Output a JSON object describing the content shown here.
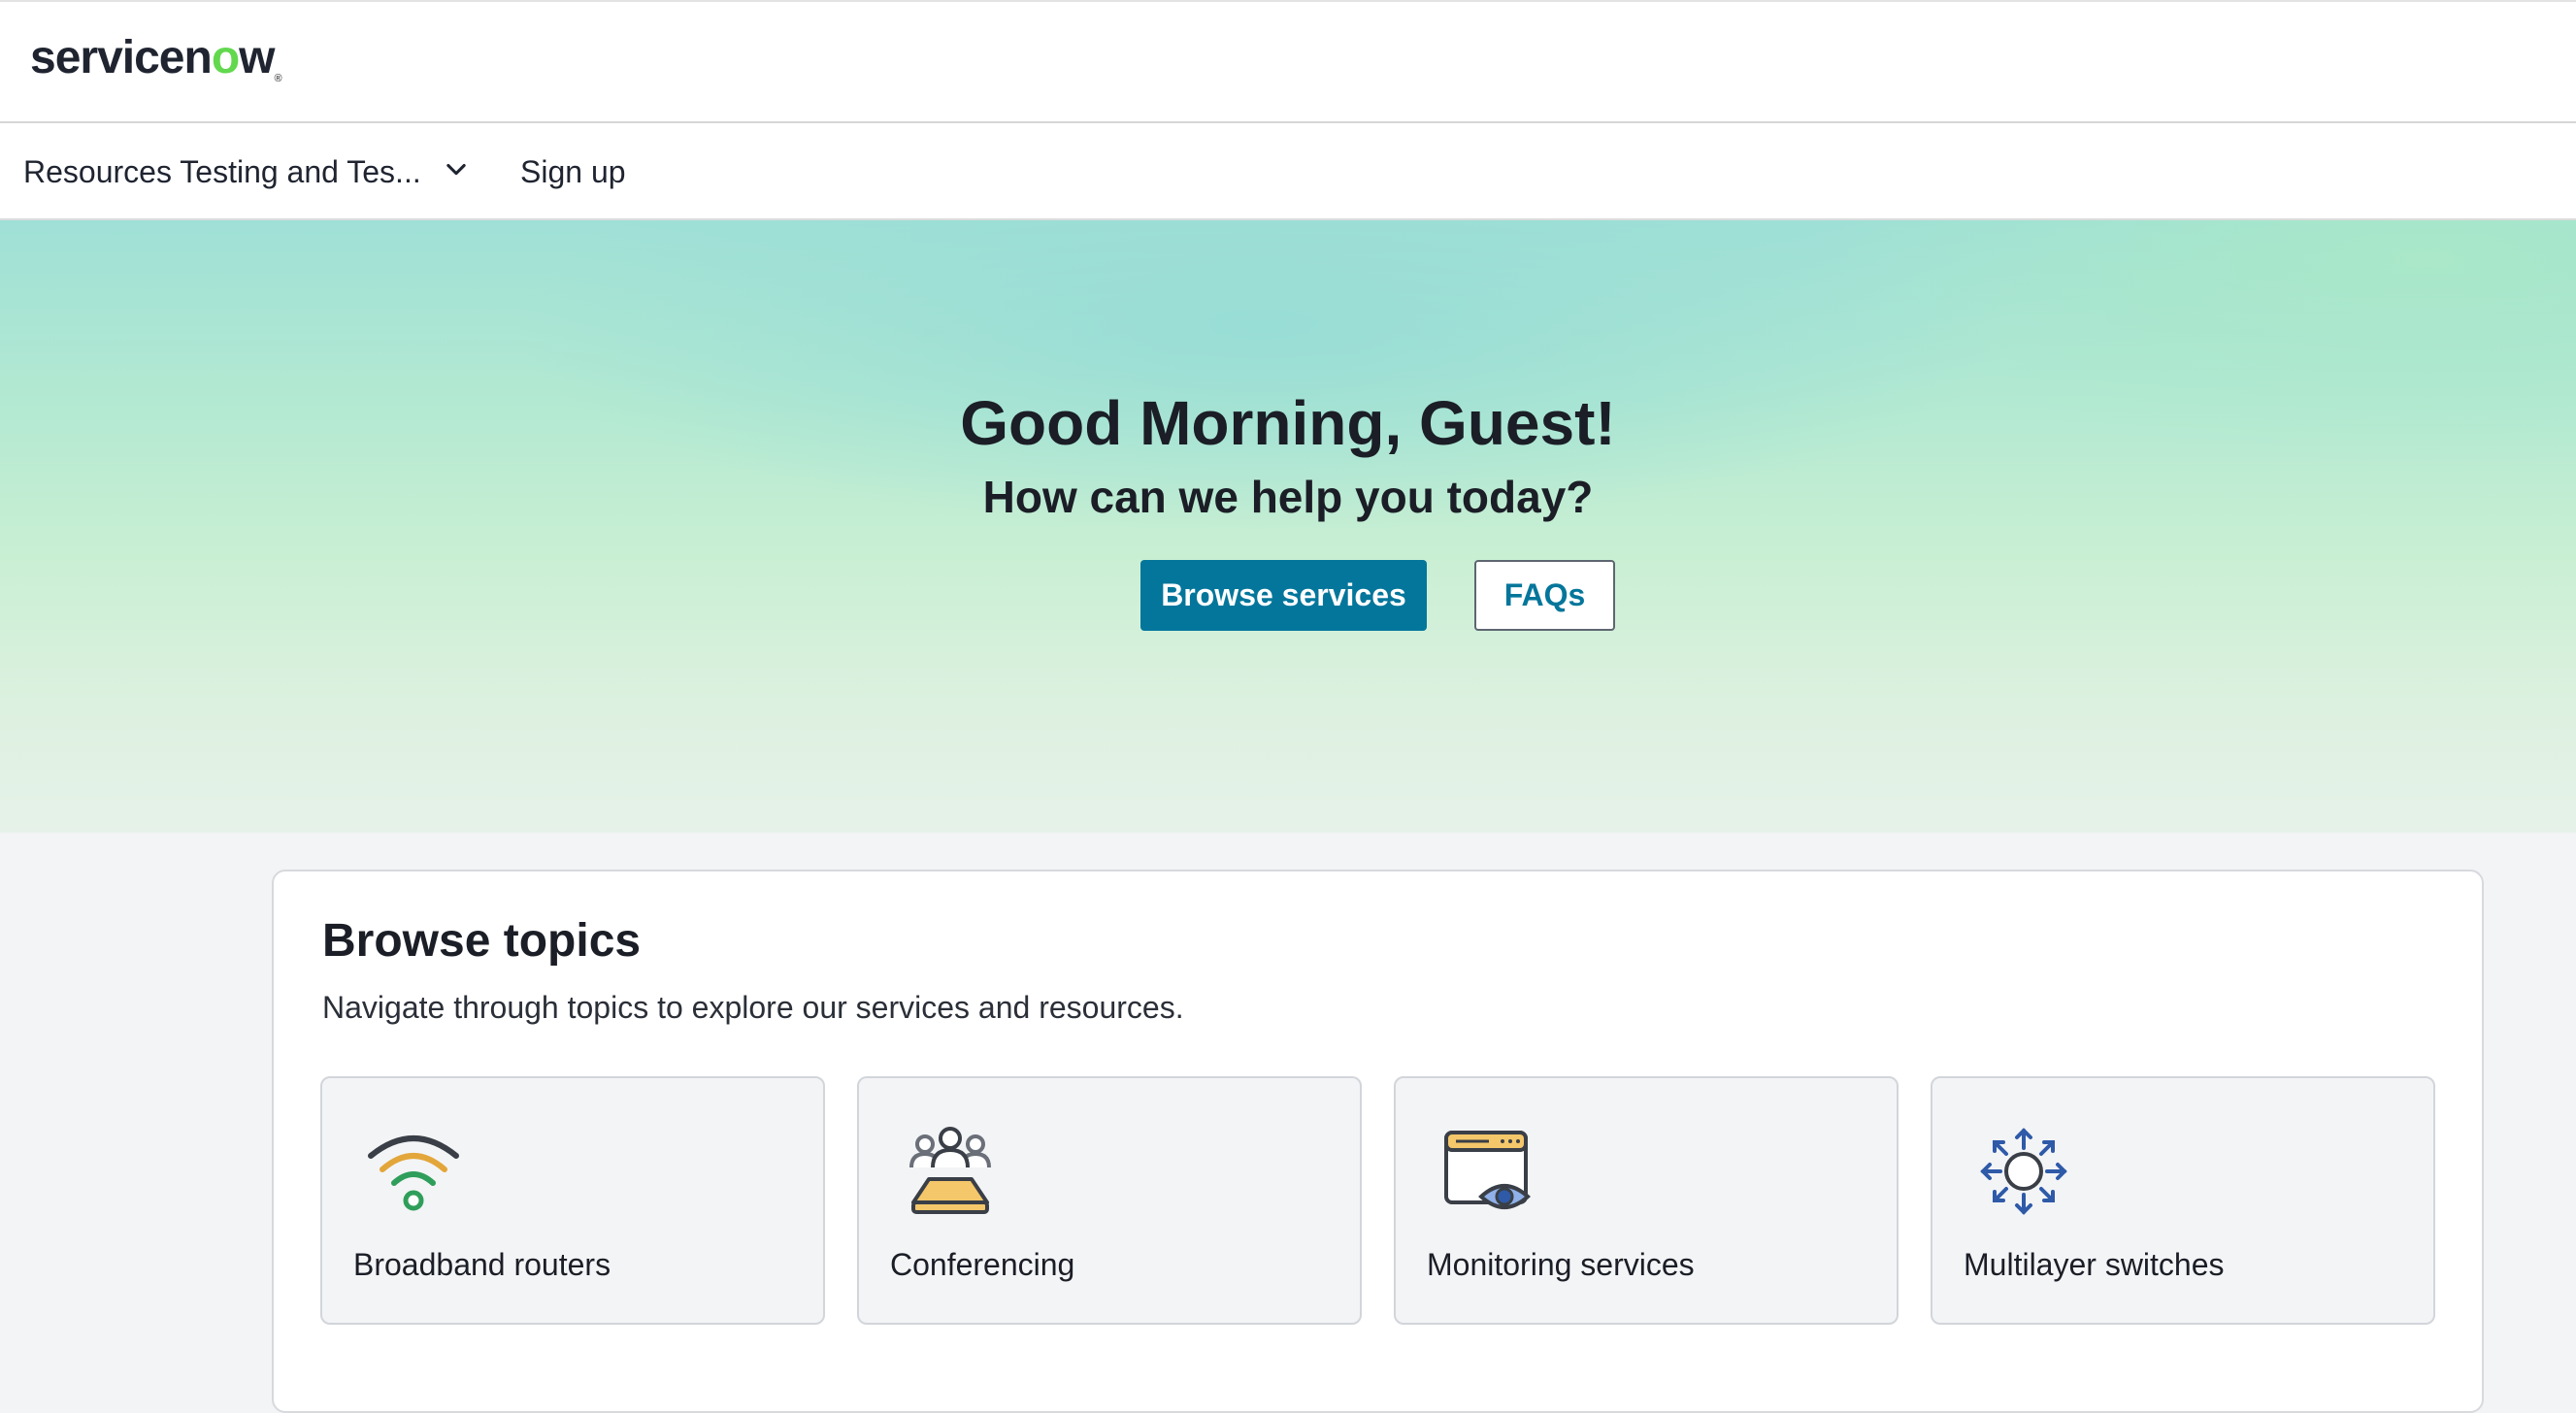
{
  "header": {
    "logo_text_prefix": "servicen",
    "logo_text_o": "o",
    "logo_text_suffix": "w",
    "logo_reg": "®"
  },
  "nav": {
    "menu_label": "Resources Testing and Tes...",
    "menu_icon": "chevron-down-icon",
    "signup_label": "Sign up"
  },
  "hero": {
    "title": "Good Morning, Guest!",
    "subtitle": "How can we help you today?",
    "primary_button": "Browse services",
    "secondary_button": "FAQs"
  },
  "topics": {
    "title": "Browse topics",
    "description": "Navigate through topics to explore our services and resources.",
    "items": [
      {
        "label": "Broadband routers",
        "icon": "wifi-icon"
      },
      {
        "label": "Conferencing",
        "icon": "people-icon"
      },
      {
        "label": "Monitoring services",
        "icon": "monitor-eye-icon"
      },
      {
        "label": "Multilayer switches",
        "icon": "switch-arrows-icon"
      }
    ]
  },
  "colors": {
    "accent": "#04769b",
    "logo_green": "#62d84e",
    "hero_top": "#9fe0d6",
    "hero_bottom": "#e6f2e9"
  }
}
